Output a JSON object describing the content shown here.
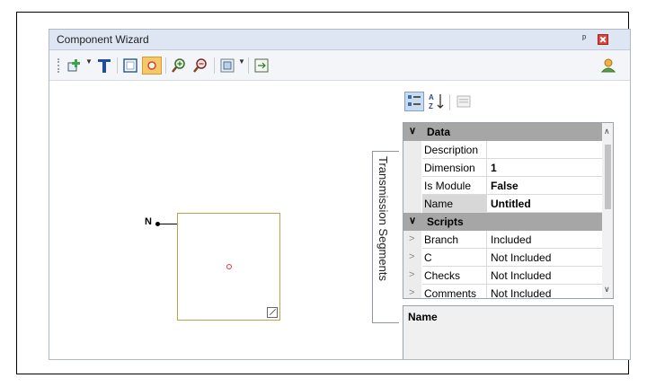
{
  "window": {
    "title": "Component Wizard",
    "pin_glyph": "ᵖ"
  },
  "toolbar": {
    "icons": [
      "add-component-icon",
      "text-icon",
      "border-icon",
      "pin-icon",
      "zoom-in-icon",
      "zoom-out-icon",
      "layout-icon",
      "fit-icon",
      "user-icon"
    ]
  },
  "canvas": {
    "pin_label": "N",
    "side_tab": "Transmission Segments"
  },
  "property_grid": {
    "categories": [
      {
        "name": "Data",
        "properties": [
          {
            "name": "Description",
            "value": ""
          },
          {
            "name": "Dimension",
            "value": "1"
          },
          {
            "name": "Is Module",
            "value": "False"
          },
          {
            "name": "Name",
            "value": "Untitled"
          }
        ]
      },
      {
        "name": "Scripts",
        "properties": [
          {
            "name": "Branch",
            "value": "Included"
          },
          {
            "name": "C",
            "value": "Not Included"
          },
          {
            "name": "Checks",
            "value": "Not Included"
          },
          {
            "name": "Comments",
            "value": "Not Included"
          }
        ]
      }
    ],
    "description_title": "Name"
  },
  "colors": {
    "title_bar": "#dde6f2",
    "category_row": "#a6a6a6",
    "close_button": "#d9443a",
    "selected_tool": "#f5c86a"
  }
}
